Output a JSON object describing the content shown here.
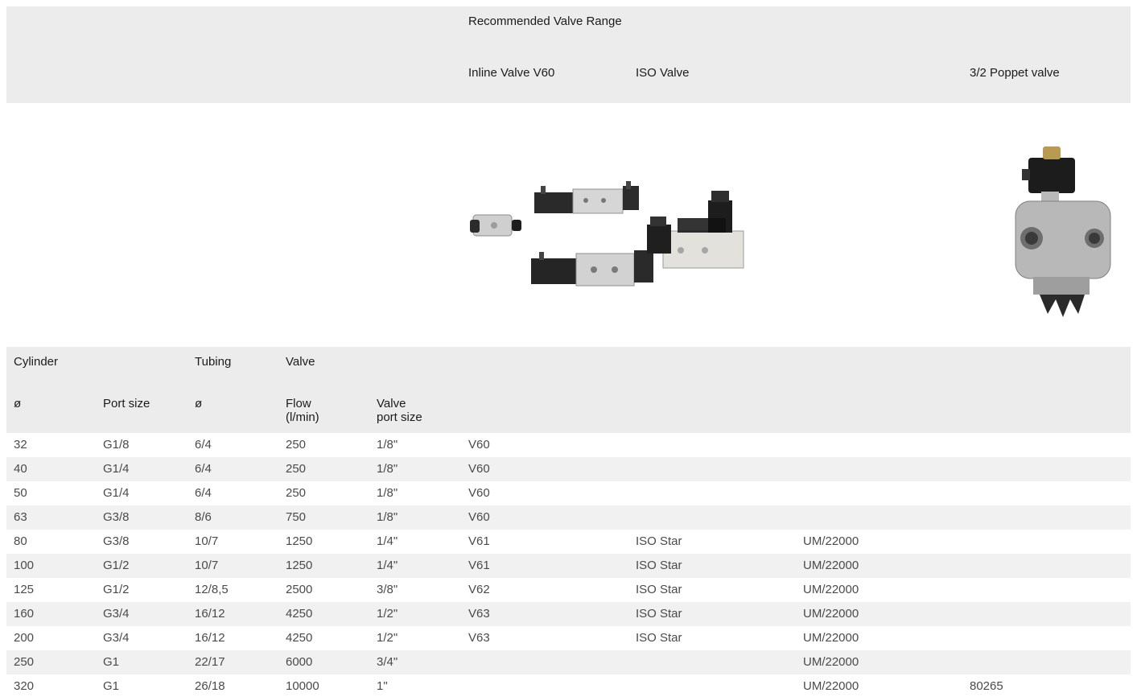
{
  "header": {
    "group_title": "Recommended Valve Range",
    "valves": {
      "inline": "Inline Valve V60",
      "iso": "ISO Valve",
      "poppet": "3/2 Poppet valve"
    }
  },
  "images": {
    "inline_iso": "inline-and-iso-valves-photo",
    "poppet": "poppet-valve-photo"
  },
  "columns": {
    "cylinder": "Cylinder",
    "tubing": "Tubing",
    "valve": "Valve",
    "diameter": "ø",
    "port_size": "Port size",
    "tubing_diameter": "ø",
    "flow_line1": "Flow",
    "flow_line2": "(l/min)",
    "valve_port_line1": "Valve",
    "valve_port_line2": "port size"
  },
  "rows": [
    [
      "32",
      "G1/8",
      "6/4",
      "250",
      "1/8\"",
      "V60",
      "",
      "",
      ""
    ],
    [
      "40",
      "G1/4",
      "6/4",
      "250",
      "1/8\"",
      "V60",
      "",
      "",
      ""
    ],
    [
      "50",
      "G1/4",
      "6/4",
      "250",
      "1/8\"",
      "V60",
      "",
      "",
      ""
    ],
    [
      "63",
      "G3/8",
      "8/6",
      "750",
      "1/8\"",
      "V60",
      "",
      "",
      ""
    ],
    [
      "80",
      "G3/8",
      "10/7",
      "1250",
      "1/4\"",
      "V61",
      "ISO Star",
      "UM/22000",
      ""
    ],
    [
      "100",
      "G1/2",
      "10/7",
      "1250",
      "1/4\"",
      "V61",
      "ISO Star",
      "UM/22000",
      ""
    ],
    [
      "125",
      "G1/2",
      "12/8,5",
      "2500",
      "3/8\"",
      "V62",
      "ISO Star",
      "UM/22000",
      ""
    ],
    [
      "160",
      "G3/4",
      "16/12",
      "4250",
      "1/2\"",
      "V63",
      "ISO Star",
      "UM/22000",
      ""
    ],
    [
      "200",
      "G3/4",
      "16/12",
      "4250",
      "1/2\"",
      "V63",
      "ISO Star",
      "UM/22000",
      ""
    ],
    [
      "250",
      "G1",
      "22/17",
      "6000",
      "3/4\"",
      "",
      "",
      "UM/22000",
      ""
    ],
    [
      "320",
      "G1",
      "26/18",
      "10000",
      "1\"",
      "",
      "",
      "UM/22000",
      "80265"
    ]
  ]
}
